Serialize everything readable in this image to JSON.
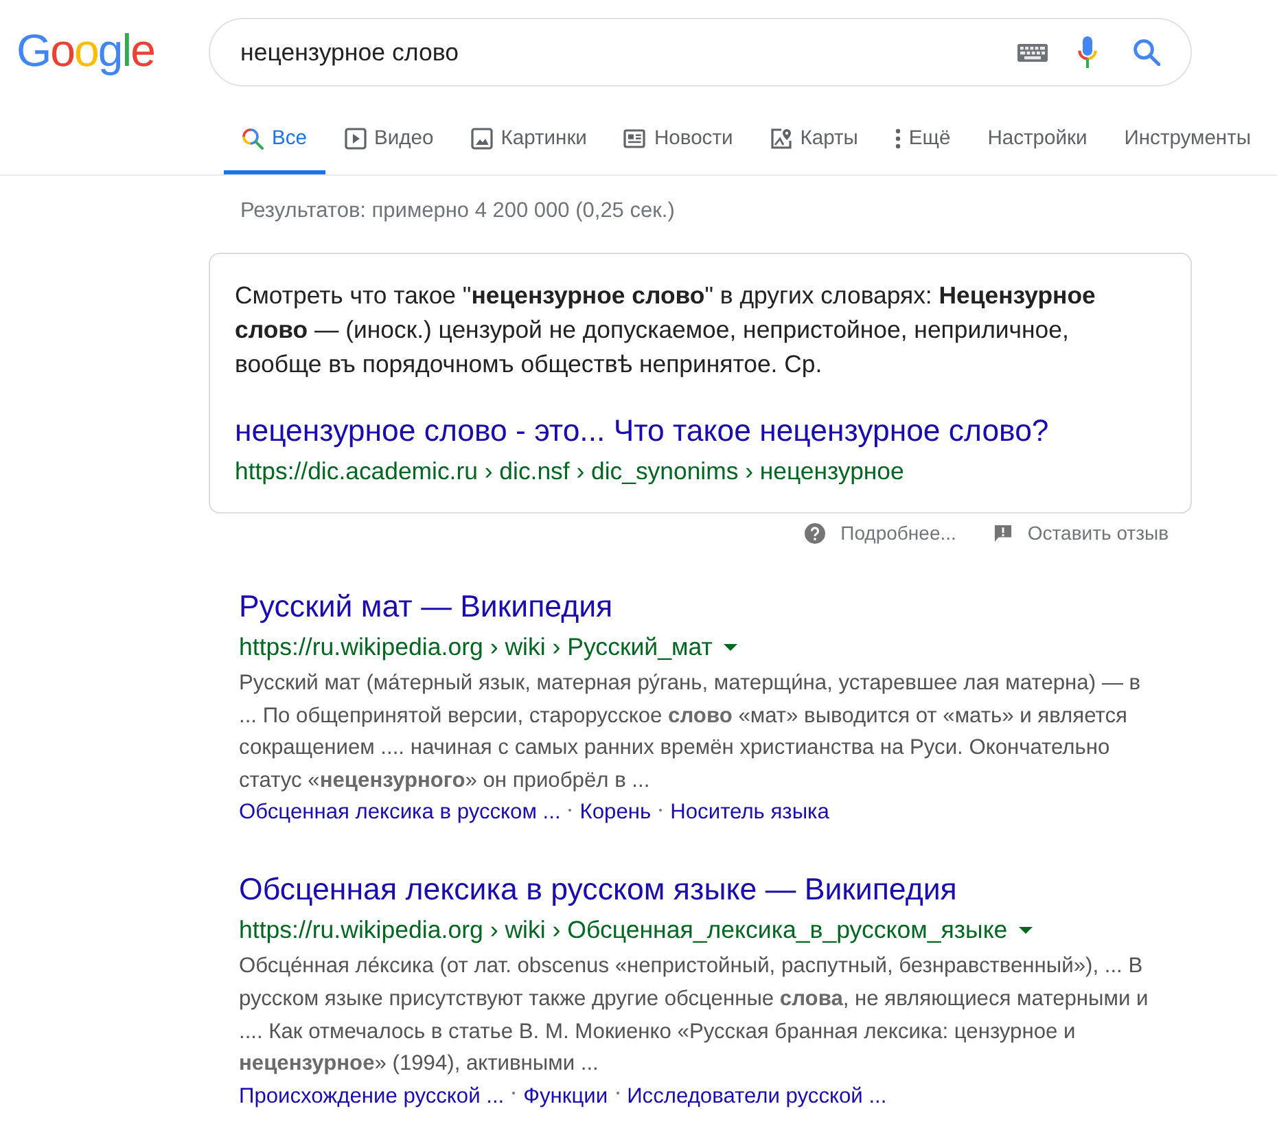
{
  "logo": "Google",
  "search": {
    "value": "нецензурное слово"
  },
  "tabs": [
    {
      "label": "Все",
      "kind": "search",
      "selected": true
    },
    {
      "label": "Видео",
      "kind": "video",
      "selected": false
    },
    {
      "label": "Картинки",
      "kind": "image",
      "selected": false
    },
    {
      "label": "Новости",
      "kind": "news",
      "selected": false
    },
    {
      "label": "Карты",
      "kind": "map",
      "selected": false
    },
    {
      "label": "Ещё",
      "kind": "more",
      "selected": false
    },
    {
      "label": "Настройки",
      "kind": "plain",
      "selected": false
    },
    {
      "label": "Инструменты",
      "kind": "plain",
      "selected": false
    }
  ],
  "result_stats": "Результатов: примерно 4 200 000 (0,25 сек.)",
  "featured_snippet": {
    "text": "Смотреть что такое \"**нецензурное слово**\" в других словарях: **Нецензурное слово** — (иноск.) цензурой не допускаемое, непристойное, неприличное, вообще въ порядочномъ обществѣ непринятое. Ср.",
    "title": "нецензурное слово - это... Что такое нецензурное слово?",
    "url": "https://dic.academic.ru › dic.nsf › dic_synonims › нецензурное"
  },
  "feedback": [
    {
      "kind": "help",
      "label": "Подробнее..."
    },
    {
      "kind": "report",
      "label": "Оставить отзыв"
    }
  ],
  "results": [
    {
      "title": "Русский мат — Википедия",
      "url": "https://ru.wikipedia.org › wiki › Русский_мат",
      "snippet": "Русский мат (ма́терный язык, матерная ру́гань, матерщи́на, устаревшее лая матерна) — в ... По общепринятой версии, старорусское **слово** «мат» выводится от «мать» и является сокращением .... начиная с самых ранних времён христианства на Руси. Окончательно статус «**нецензурного**» он приобрёл в ...",
      "sitelinks": [
        "Обсценная лексика в русском ...",
        "Корень",
        "Носитель языка"
      ]
    },
    {
      "title": "Обсценная лексика в русском языке — Википедия",
      "url": "https://ru.wikipedia.org › wiki › Обсценная_лексика_в_русском_языке",
      "snippet": "Обсце́нная ле́ксика (от лат. obscenus «непристойный, распутный, безнравственный»), ... В русском языке присутствуют также другие обсценные **слова**, не являющиеся матерными и .... Как отмечалось в статье В. М. Мокиенко «Русская бранная лексика: цензурное и **нецензурное**» (1994), активными ...",
      "sitelinks": [
        "Происхождение русской ...",
        "Функции",
        "Исследователи русской ..."
      ]
    }
  ]
}
